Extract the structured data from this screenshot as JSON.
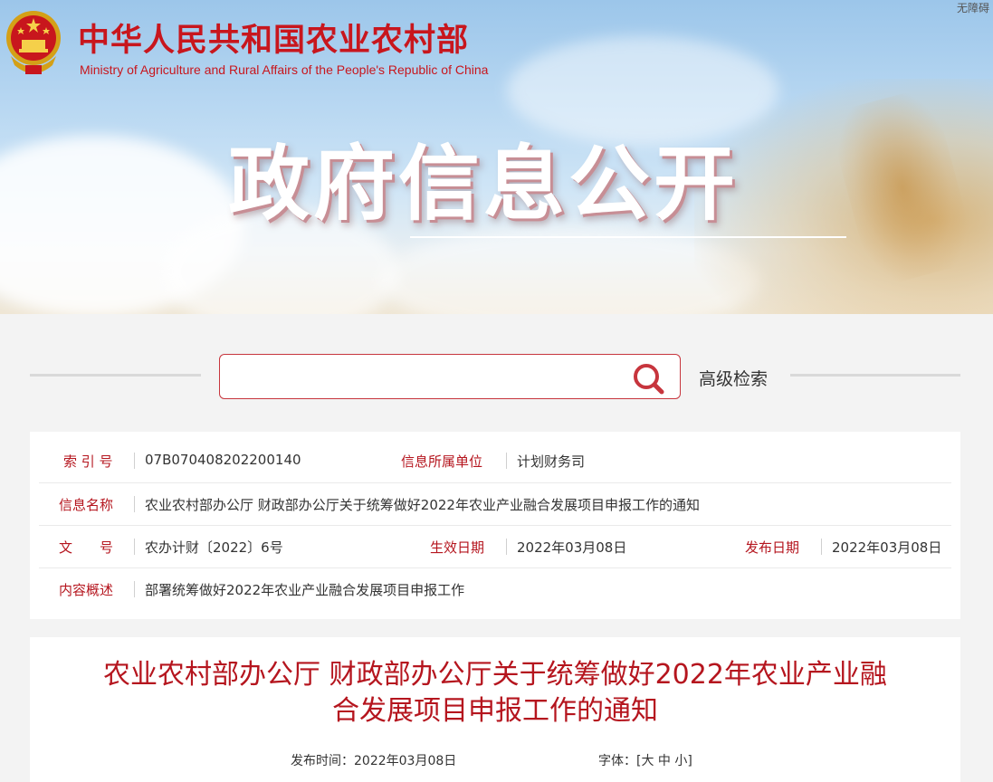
{
  "header": {
    "brand_cn": "中华人民共和国农业农村部",
    "brand_en": "Ministry of Agriculture and Rural Affairs of the People's Republic of China",
    "accessibility_link": "无障碍",
    "banner_title": "政府信息公开",
    "emblem_icon": "national-emblem-icon"
  },
  "search": {
    "placeholder": "",
    "value": "",
    "advanced_label": "高级检索",
    "icon": "search-icon"
  },
  "meta": {
    "index_label": "索 引 号",
    "index_value": "07B070408202200140",
    "unit_label": "信息所属单位",
    "unit_value": "计划财务司",
    "name_label": "信息名称",
    "name_value": "农业农村部办公厅 财政部办公厅关于统筹做好2022年农业产业融合发展项目申报工作的通知",
    "doc_label": "文　　号",
    "doc_value": "农办计财〔2022〕6号",
    "effective_label": "生效日期",
    "effective_value": "2022年03月08日",
    "publish_label": "发布日期",
    "publish_value": "2022年03月08日",
    "summary_label": "内容概述",
    "summary_value": "部署统筹做好2022年农业产业融合发展项目申报工作"
  },
  "article": {
    "title_line1": "农业农村部办公厅 财政部办公厅关于统筹做好2022年农业产业融",
    "title_line2": "合发展项目申报工作的通知",
    "pub_label": "发布时间：",
    "pub_date": "2022年03月08日",
    "font_label": "字体：",
    "font_open": "[",
    "font_large": "大",
    "font_medium": "中",
    "font_small": "小",
    "font_close": "]"
  },
  "colors": {
    "brand_red": "#c8161d",
    "label_red": "#b5151e"
  }
}
